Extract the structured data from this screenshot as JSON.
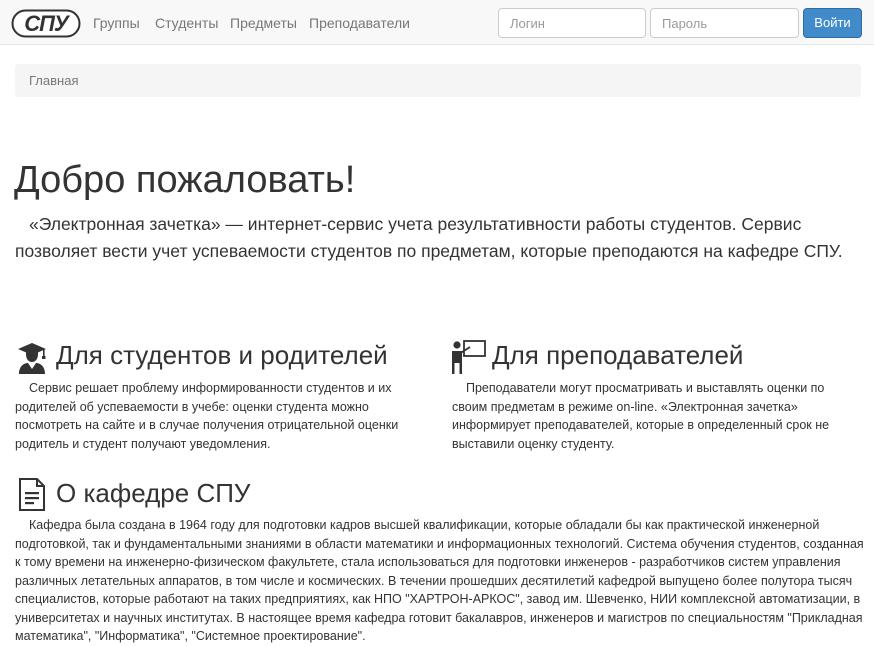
{
  "navbar": {
    "brand_text": "СПУ",
    "links": [
      "Группы",
      "Студенты",
      "Предметы",
      "Преподаватели"
    ],
    "login_placeholder": "Логин",
    "password_placeholder": "Пароль",
    "login_button": "Войти"
  },
  "breadcrumb": {
    "home": "Главная"
  },
  "hero": {
    "title": "Добро пожаловать!",
    "text": "«Электронная зачетка» — интернет-сервис учета результативности работы студентов. Сервис позволяет вести учет успеваемости студентов по предметам, которые преподаются на кафедре СПУ."
  },
  "students": {
    "icon": "graduate-icon",
    "title": "Для студентов и родителей",
    "text": "Сервис решает проблему информированности студентов и их родителей об успеваемости в учебе: оценки студента можно посмотреть на сайте и в случае получения отрицательной оценки родитель и студент получают уведомления."
  },
  "teachers": {
    "icon": "teacher-board-icon",
    "title": "Для преподавателей",
    "text": "Преподаватели могут просматривать и выставлять оценки по своим предметам в режиме on-line. «Электронная зачетка» информирует преподавателей, которые в определенный срок не выставили оценку студенту."
  },
  "about": {
    "icon": "document-icon",
    "title": "О кафедре СПУ",
    "text": "Кафедра была создана в 1964 году для подготовки кадров высшей квалификации, которые обладали бы как практической инженерной подготовкой, так и фундаментальными знаниями в области математики и информационных технологий. Система обучения студентов, созданная к тому времени на инженерно-физическом факультете, стала использоваться для подготовки инженеров - разработчиков систем управления различных летательных аппаратов, в том числе и космических. В течении прошедших десятилетий кафедрой выпущено более полутора тысяч специалистов, которые работают на таких предприятиях, как НПО \"ХАРТРОН-АРКОС\", завод им. Шевченко, НИИ комплексной автоматизации, в университетах и научных институтах. В настоящее время кафедра готовит бакалавров, инженеров и магистров по специальностям \"Прикладная математика\", \"Информатика\", \"Системное проектирование\"."
  },
  "colors": {
    "navbar_bg": "#f8f8f8",
    "primary_button": "#428bca",
    "breadcrumb_bg": "#f5f5f5",
    "text": "#333333",
    "muted": "#777777"
  }
}
